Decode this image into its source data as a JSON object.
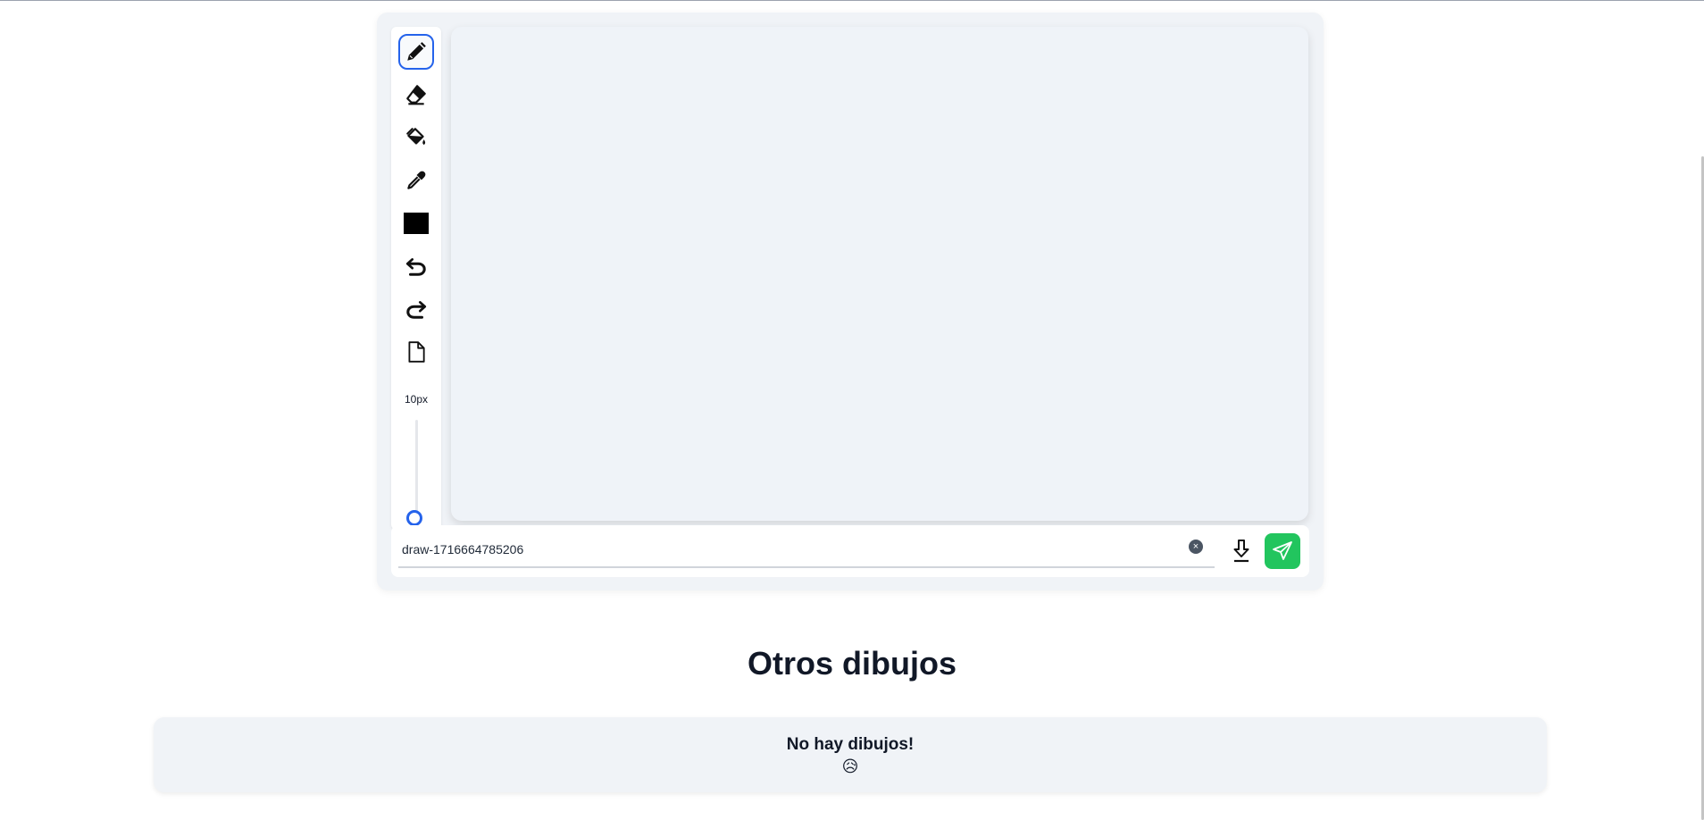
{
  "toolbar": {
    "tools": [
      {
        "name": "pencil-icon",
        "active": true
      },
      {
        "name": "eraser-icon",
        "active": false
      },
      {
        "name": "paint-bucket-icon",
        "active": false
      },
      {
        "name": "eyedropper-icon",
        "active": false
      },
      {
        "name": "color-swatch",
        "active": false
      },
      {
        "name": "undo-icon",
        "active": false
      },
      {
        "name": "redo-icon",
        "active": false
      },
      {
        "name": "new-file-icon",
        "active": false
      }
    ],
    "current_color": "#000000",
    "brush_size_label": "10px",
    "brush_size_level": 0.0
  },
  "name_bar": {
    "filename": "draw-1716664785206",
    "clear_symbol": "×"
  },
  "gallery": {
    "title": "Otros dibujos",
    "empty_title": "No hay dibujos!",
    "empty_emoji": "😥"
  },
  "colors": {
    "accent": "#2563eb",
    "send": "#22c55e",
    "panel": "#f0f3f7"
  }
}
